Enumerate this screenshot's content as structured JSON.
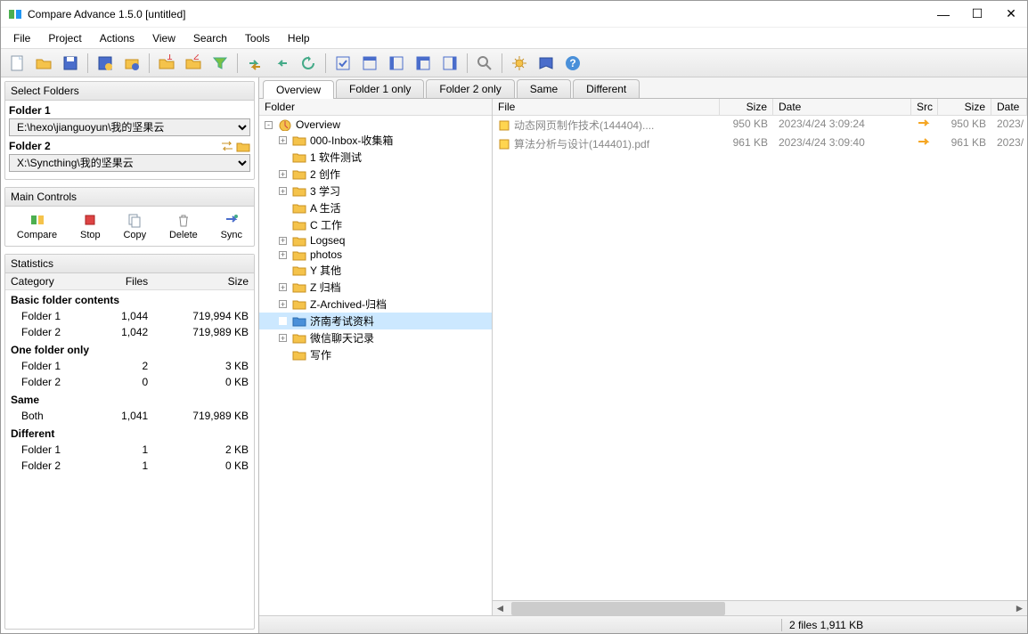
{
  "window": {
    "title": "Compare Advance 1.5.0 [untitled]"
  },
  "menu": [
    "File",
    "Project",
    "Actions",
    "View",
    "Search",
    "Tools",
    "Help"
  ],
  "left": {
    "select_header": "Select Folders",
    "folder1_label": "Folder 1",
    "folder1_value": "E:\\hexo\\jianguoyun\\我的坚果云",
    "folder2_label": "Folder 2",
    "folder2_value": "X:\\Syncthing\\我的坚果云",
    "controls_header": "Main Controls",
    "controls": [
      {
        "label": "Compare"
      },
      {
        "label": "Stop"
      },
      {
        "label": "Copy"
      },
      {
        "label": "Delete"
      },
      {
        "label": "Sync"
      }
    ],
    "stats_header": "Statistics",
    "stats_cols": [
      "Category",
      "Files",
      "Size"
    ],
    "stats": [
      {
        "group": "Basic folder contents"
      },
      {
        "label": "Folder 1",
        "files": "1,044",
        "size": "719,994 KB"
      },
      {
        "label": "Folder 2",
        "files": "1,042",
        "size": "719,989 KB"
      },
      {
        "group": "One folder only"
      },
      {
        "label": "Folder 1",
        "files": "2",
        "size": "3 KB"
      },
      {
        "label": "Folder 2",
        "files": "0",
        "size": "0 KB"
      },
      {
        "group": "Same"
      },
      {
        "label": "Both",
        "files": "1,041",
        "size": "719,989 KB"
      },
      {
        "group": "Different"
      },
      {
        "label": "Folder 1",
        "files": "1",
        "size": "2 KB"
      },
      {
        "label": "Folder 2",
        "files": "1",
        "size": "0 KB"
      }
    ]
  },
  "tabs": [
    "Overview",
    "Folder 1 only",
    "Folder 2 only",
    "Same",
    "Different"
  ],
  "tree": {
    "header": "Folder",
    "items": [
      {
        "indent": 0,
        "expand": "-",
        "icon": "overview",
        "label": "Overview"
      },
      {
        "indent": 1,
        "expand": "+",
        "icon": "folder",
        "label": "000-Inbox-收集箱"
      },
      {
        "indent": 1,
        "expand": "",
        "icon": "folder",
        "label": "1 软件测试"
      },
      {
        "indent": 1,
        "expand": "+",
        "icon": "folder",
        "label": "2 创作"
      },
      {
        "indent": 1,
        "expand": "+",
        "icon": "folder",
        "label": "3 学习"
      },
      {
        "indent": 1,
        "expand": "",
        "icon": "folder",
        "label": "A 生活"
      },
      {
        "indent": 1,
        "expand": "",
        "icon": "folder",
        "label": "C 工作"
      },
      {
        "indent": 1,
        "expand": "+",
        "icon": "folder",
        "label": "Logseq"
      },
      {
        "indent": 1,
        "expand": "+",
        "icon": "folder",
        "label": "photos"
      },
      {
        "indent": 1,
        "expand": "",
        "icon": "folder",
        "label": "Y 其他"
      },
      {
        "indent": 1,
        "expand": "+",
        "icon": "folder",
        "label": "Z 归档"
      },
      {
        "indent": 1,
        "expand": "+",
        "icon": "folder",
        "label": "Z-Archived-归档"
      },
      {
        "indent": 1,
        "expand": "",
        "icon": "folder-sel",
        "label": "济南考试资料",
        "selected": true
      },
      {
        "indent": 1,
        "expand": "+",
        "icon": "folder",
        "label": "微信聊天记录"
      },
      {
        "indent": 1,
        "expand": "",
        "icon": "folder",
        "label": "写作"
      }
    ]
  },
  "files": {
    "cols": [
      "File",
      "Size",
      "Date",
      "Src",
      "Size",
      "Date"
    ],
    "rows": [
      {
        "name": "动态网页制作技术(144404)....",
        "size1": "950 KB",
        "date1": "2023/4/24 3:09:24",
        "src": "→",
        "size2": "950 KB",
        "date2": "2023/"
      },
      {
        "name": "算法分析与设计(144401).pdf",
        "size1": "961 KB",
        "date1": "2023/4/24 3:09:40",
        "src": "→",
        "size2": "961 KB",
        "date2": "2023/"
      }
    ]
  },
  "status": {
    "text": "2 files 1,911 KB"
  }
}
